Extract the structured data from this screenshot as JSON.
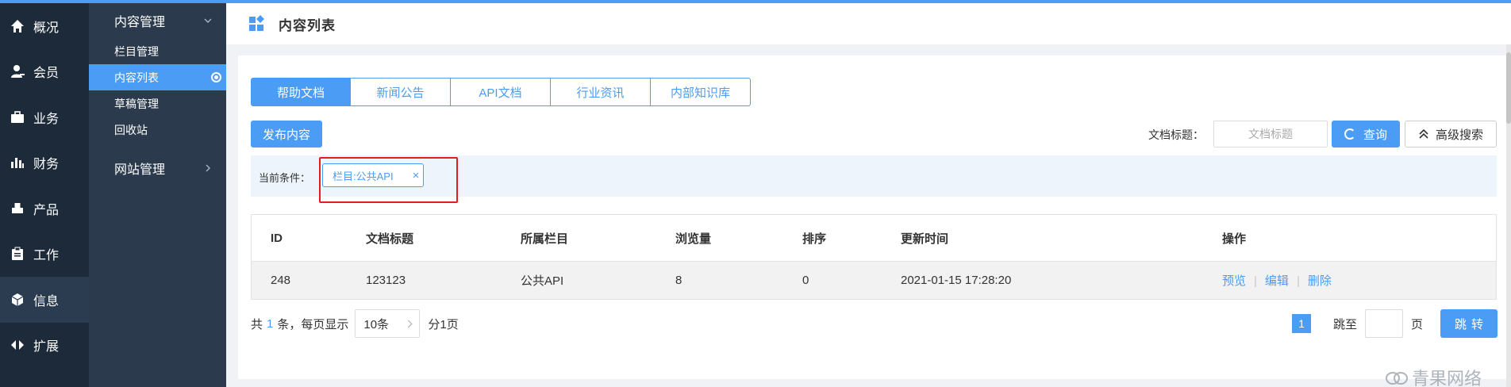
{
  "sidebar": {
    "items": [
      {
        "label": "概况",
        "icon": "home-icon"
      },
      {
        "label": "会员",
        "icon": "user-icon"
      },
      {
        "label": "业务",
        "icon": "briefcase-icon"
      },
      {
        "label": "财务",
        "icon": "chart-bar-icon"
      },
      {
        "label": "产品",
        "icon": "cubes-icon"
      },
      {
        "label": "工作",
        "icon": "clipboard-icon"
      },
      {
        "label": "信息",
        "icon": "cube-icon"
      },
      {
        "label": "扩展",
        "icon": "expand-arrows-icon"
      }
    ]
  },
  "subnav": {
    "group1": "内容管理",
    "items": [
      "栏目管理",
      "内容列表",
      "草稿管理",
      "回收站"
    ],
    "group2": "网站管理"
  },
  "header": {
    "title": "内容列表"
  },
  "tabs": [
    "帮助文档",
    "新闻公告",
    "API文档",
    "行业资讯",
    "内部知识库"
  ],
  "toolbar": {
    "publish": "发布内容",
    "search_label": "文档标题：",
    "search_placeholder": "文档标题",
    "query": "查询",
    "advanced": "高级搜索"
  },
  "condition": {
    "label": "当前条件：",
    "chip": "栏目:公共API",
    "close": "×"
  },
  "table": {
    "headers": [
      "ID",
      "文档标题",
      "所属栏目",
      "浏览量",
      "排序",
      "更新时间",
      "操作"
    ],
    "rows": [
      {
        "id": "248",
        "title": "123123",
        "column": "公共API",
        "views": "8",
        "sort": "0",
        "updated": "2021-01-15 17:28:20"
      }
    ],
    "actions": [
      "预览",
      "编辑",
      "删除"
    ],
    "separator": "|"
  },
  "pager": {
    "prefix": "共",
    "total": "1",
    "mid": "条，每页显示",
    "page_size": "10条",
    "pages": "分1页",
    "current": "1",
    "jump_label": "跳至",
    "page_unit": "页",
    "go": "跳转"
  },
  "watermark": "青果网络",
  "colors": {
    "accent": "#4a9cf5",
    "sidebar": "#1d2a3a",
    "subnav": "#2b3a4d",
    "highlight": "#e02020"
  }
}
